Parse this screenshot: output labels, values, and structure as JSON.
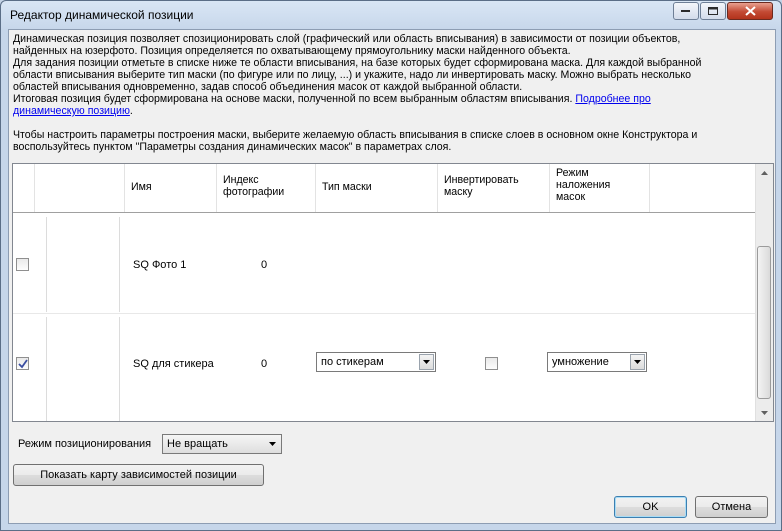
{
  "window": {
    "title": "Редактор динамической позиции"
  },
  "description": {
    "p1": "Динамическая позиция позволяет спозиционировать слой (графический или область вписывания) в зависимости от позиции объектов,\nнайденных на юзерфото. Позиция определяется по охватывающему прямоугольнику маски найденного объекта.",
    "p2": "Для задания позиции отметьте в списке ниже те области вписывания, на базе которых будет сформирована маска. Для каждой выбранной\nобласти вписывания выберите тип маски (по фигуре или по лицу, ...) и укажите, надо ли инвертировать маску. Можно выбрать несколько\nобластей вписывания одновременно, задав способ объединения масок от каждой выбранной области.",
    "p3_text": "Итоговая позиция будет сформирована на основе маски, полученной по всем выбранным областям вписывания. ",
    "p3_link_a": "Подробнее про",
    "p3_link_b": "динамическую позицию",
    "p3_end": ".",
    "p4": "Чтобы настроить параметры построения маски, выберите желаемую область вписывания в списке слоев в основном окне Конструктора и\nвоспользуйтесь пунктом \"Параметры создания динамических масок\" в параметрах слоя."
  },
  "grid": {
    "headers": {
      "name": "Имя",
      "photo_index": "Индекс\nфотографии",
      "mask_type": "Тип маски",
      "invert": "Инвертировать\nмаску",
      "blend_mode": "Режим\nналожения\nмасок"
    },
    "rows": [
      {
        "checked": false,
        "name": "SQ Фото 1",
        "photo_index": "0",
        "mask_type": "",
        "invert": false,
        "blend_mode": ""
      },
      {
        "checked": true,
        "name": "SQ для стикера",
        "photo_index": "0",
        "mask_type": "по стикерам",
        "invert": false,
        "blend_mode": "умножение"
      }
    ]
  },
  "positioning": {
    "label": "Режим позиционирования",
    "value": "Не вращать"
  },
  "buttons": {
    "show_map": "Показать карту зависимостей позиции",
    "ok": "OK",
    "cancel": "Отмена"
  },
  "icons": {
    "minimize": "minimize-icon",
    "maximize": "maximize-icon",
    "close": "close-icon",
    "checkmark": "check-icon",
    "dropdown": "chevron-down-icon"
  }
}
